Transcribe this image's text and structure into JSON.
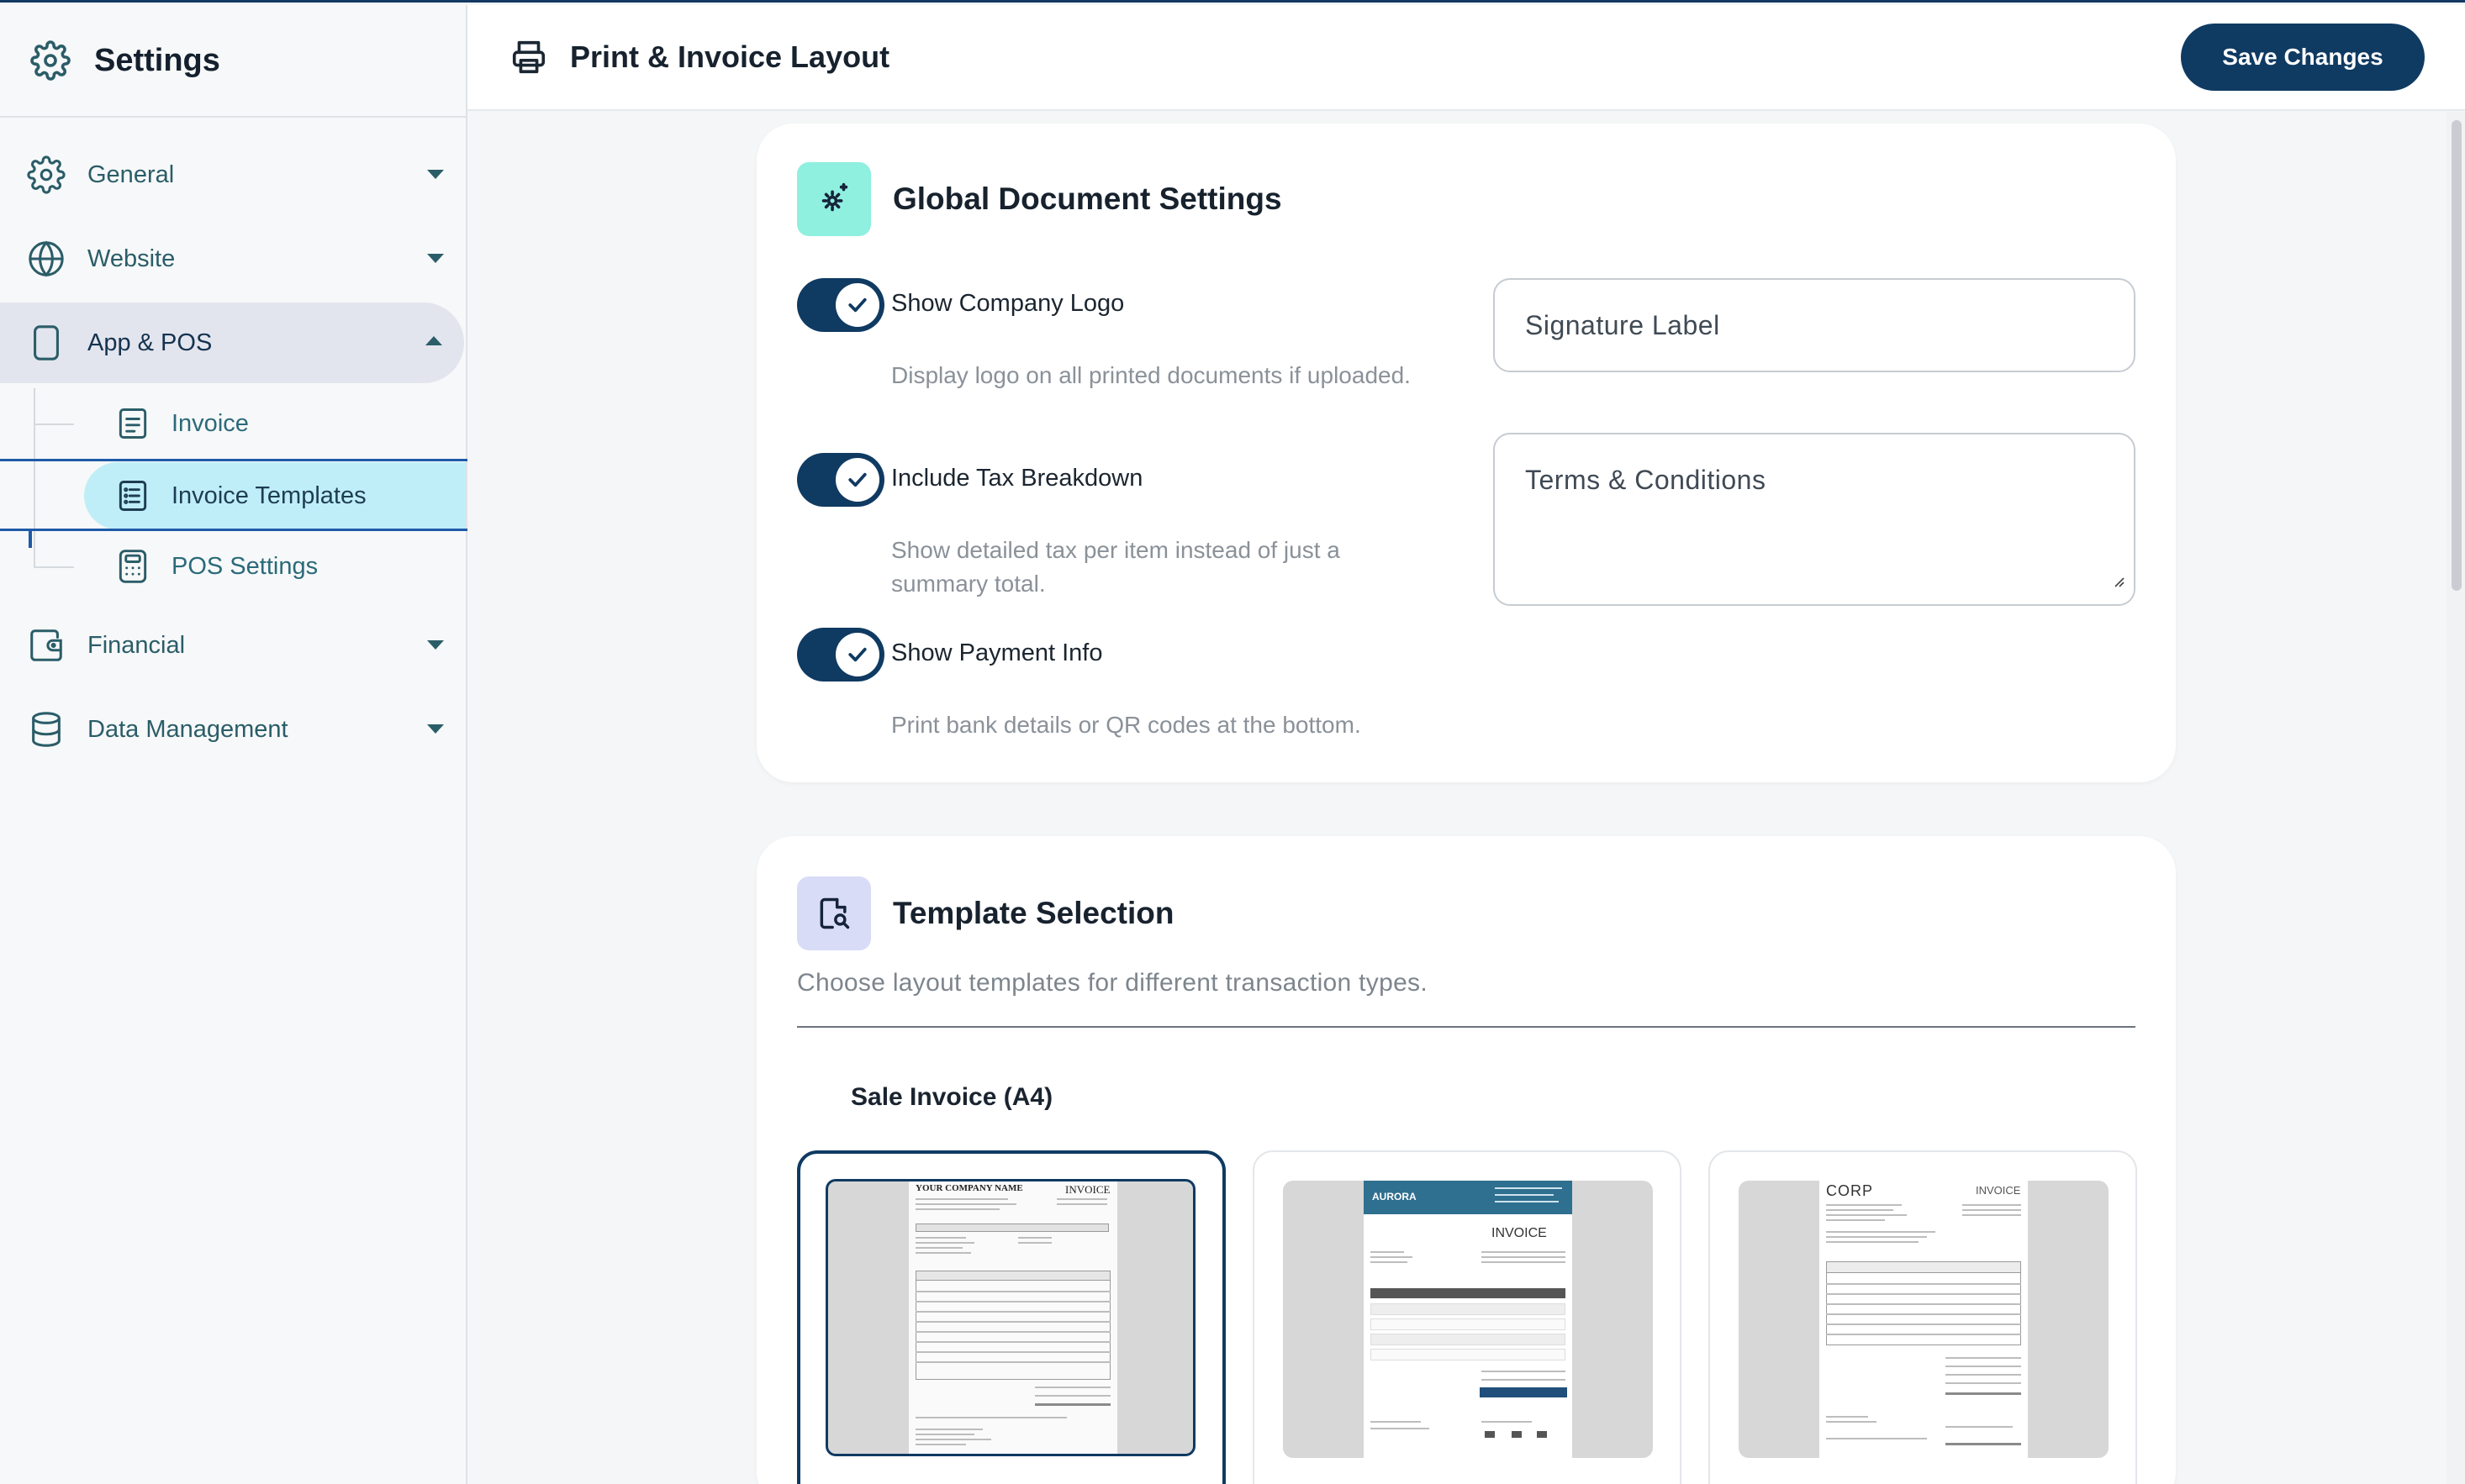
{
  "sidebar": {
    "title": "Settings",
    "items": [
      {
        "label": "General"
      },
      {
        "label": "Website"
      },
      {
        "label": "App & POS"
      },
      {
        "label": "Financial"
      },
      {
        "label": "Data Management"
      }
    ],
    "sub_items": [
      {
        "label": "Invoice"
      },
      {
        "label": "Invoice Templates"
      },
      {
        "label": "POS Settings"
      }
    ]
  },
  "header": {
    "title": "Print & Invoice Layout",
    "save_label": "Save Changes"
  },
  "global_settings": {
    "title": "Global Document Settings",
    "toggles": [
      {
        "label": "Show Company Logo",
        "description": "Display logo on all printed documents if uploaded.",
        "on": true
      },
      {
        "label": "Include Tax Breakdown",
        "description": "Show detailed tax per item instead of just a summary total.",
        "on": true
      },
      {
        "label": "Show Payment Info",
        "description": "Print bank details or QR codes at the bottom.",
        "on": true
      }
    ],
    "signature_placeholder": "Signature Label",
    "terms_placeholder": "Terms & Conditions"
  },
  "template_selection": {
    "title": "Template Selection",
    "subtitle": "Choose layout templates for different transaction types.",
    "section_label": "Sale Invoice (A4)",
    "templates": [
      {
        "company": "YOUR COMPANY NAME",
        "doc": "INVOICE",
        "selected": true
      },
      {
        "company": "AURORA",
        "doc": "INVOICE",
        "selected": false
      },
      {
        "company": "CORP",
        "doc": "INVOICE",
        "selected": false
      }
    ]
  },
  "colors": {
    "primary": "#0f3a62",
    "teal_badge": "#8ff0e0",
    "lavender_badge": "#d9dcf7",
    "active_sub": "#bfeef8",
    "aurora_header": "#2f6f8f"
  }
}
